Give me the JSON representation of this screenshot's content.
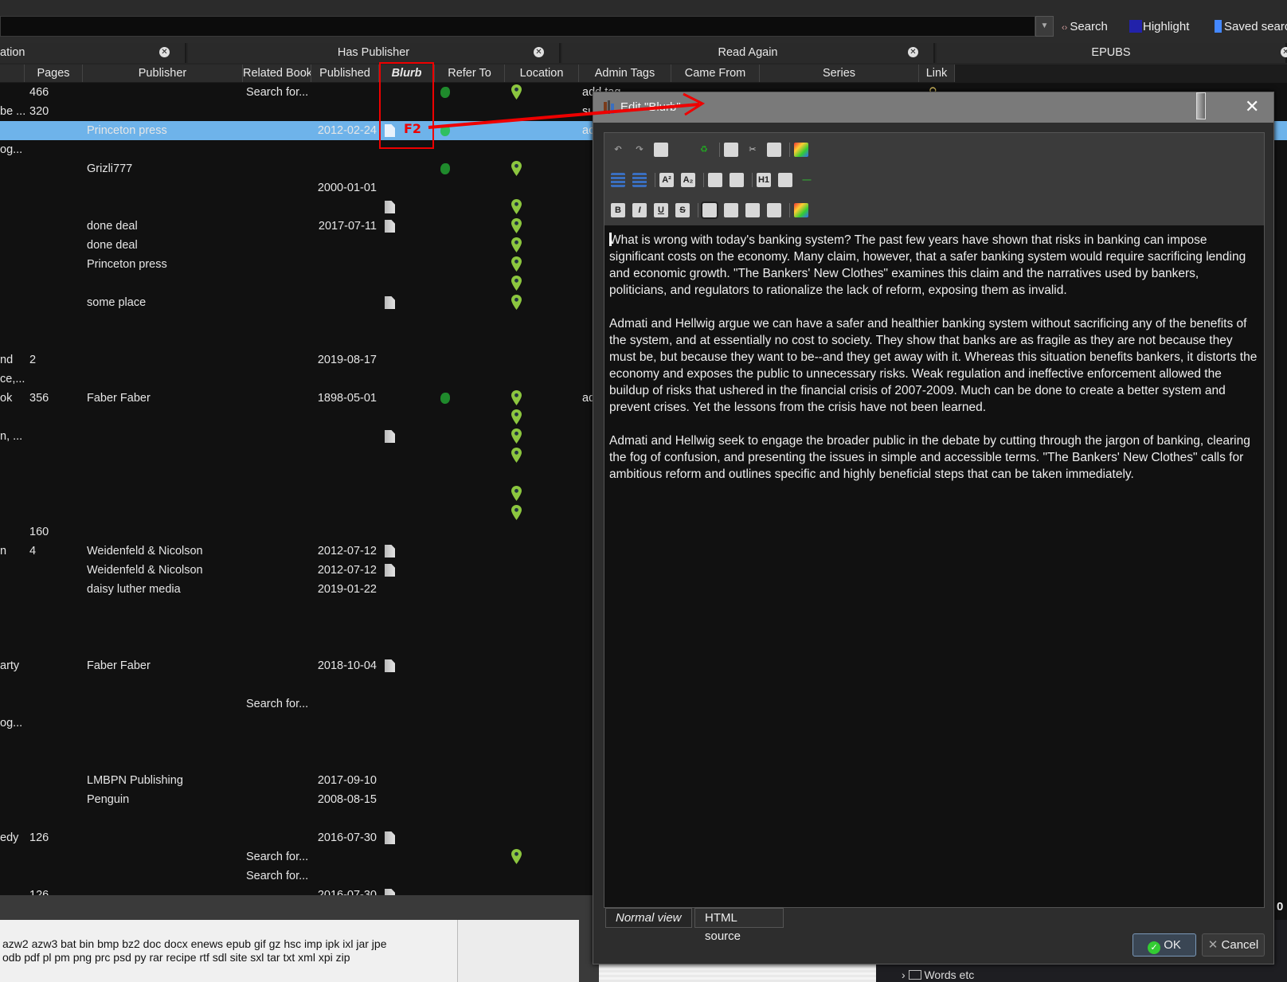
{
  "search": {
    "value": "",
    "buttons": [
      {
        "label": "Search",
        "icon": "search-icon"
      },
      {
        "label": "Highlight",
        "icon": "highlight-icon"
      },
      {
        "label": "Saved searc",
        "icon": "bookmark-icon"
      }
    ]
  },
  "tabs": [
    {
      "label": "ation"
    },
    {
      "label": "Has Publisher"
    },
    {
      "label": "Read Again"
    },
    {
      "label": "EPUBS"
    }
  ],
  "columns": [
    "",
    "Pages",
    "Publisher",
    "Related Book",
    "Published",
    "Blurb",
    "Refer To",
    "Location",
    "Admin Tags",
    "Came From",
    "Series",
    "Link"
  ],
  "rows": [
    {
      "c0": "",
      "pages": "466",
      "publisher": "",
      "related": "Search for...",
      "published": "",
      "blurb": false,
      "refer": true,
      "location": true,
      "admin": "add tag",
      "link": true
    },
    {
      "c0": "be ...",
      "pages": "320",
      "publisher": "",
      "related": "",
      "published": "",
      "blurb": false,
      "refer": false,
      "location": false,
      "admin": "su"
    },
    {
      "c0": "",
      "pages": "",
      "publisher": "Princeton press",
      "related": "",
      "published": "2012-02-24",
      "blurb": true,
      "refer": true,
      "location": false,
      "admin": "ac",
      "selected": true
    },
    {
      "c0": "og...",
      "pages": "",
      "publisher": "",
      "related": "",
      "published": "",
      "blurb": false,
      "refer": false,
      "location": false,
      "admin": ""
    },
    {
      "c0": "",
      "pages": "",
      "publisher": "Grizli777",
      "related": "",
      "published": "",
      "blurb": false,
      "refer": true,
      "location": true,
      "admin": ""
    },
    {
      "c0": "",
      "pages": "",
      "publisher": "",
      "related": "",
      "published": "2000-01-01",
      "blurb": false,
      "refer": false,
      "location": false,
      "admin": ""
    },
    {
      "c0": "",
      "pages": "",
      "publisher": "",
      "related": "",
      "published": "",
      "blurb": true,
      "refer": false,
      "location": true,
      "admin": ""
    },
    {
      "c0": "",
      "pages": "",
      "publisher": "done deal",
      "related": "",
      "published": "2017-07-11",
      "blurb": true,
      "refer": false,
      "location": true,
      "admin": ""
    },
    {
      "c0": "",
      "pages": "",
      "publisher": "done deal",
      "related": "",
      "published": "",
      "blurb": false,
      "refer": false,
      "location": true,
      "admin": ""
    },
    {
      "c0": "",
      "pages": "",
      "publisher": "Princeton press",
      "related": "",
      "published": "",
      "blurb": false,
      "refer": false,
      "location": true,
      "admin": ""
    },
    {
      "c0": "",
      "pages": "",
      "publisher": "",
      "related": "",
      "published": "",
      "blurb": false,
      "refer": false,
      "location": true,
      "admin": ""
    },
    {
      "c0": "",
      "pages": "",
      "publisher": "some place",
      "related": "",
      "published": "",
      "blurb": true,
      "refer": false,
      "location": true,
      "admin": ""
    },
    {
      "c0": "",
      "pages": "",
      "publisher": "",
      "related": "",
      "published": "",
      "blurb": false,
      "refer": false,
      "location": false,
      "admin": ""
    },
    {
      "c0": "",
      "pages": "",
      "publisher": "",
      "related": "",
      "published": "",
      "blurb": false,
      "refer": false,
      "location": false,
      "admin": ""
    },
    {
      "c0": "nd",
      "pages": "2",
      "publisher": "",
      "related": "",
      "published": "2019-08-17",
      "blurb": false,
      "refer": false,
      "location": false,
      "admin": ""
    },
    {
      "c0": "ce,...",
      "pages": "",
      "publisher": "",
      "related": "",
      "published": "",
      "blurb": false,
      "refer": false,
      "location": false,
      "admin": ""
    },
    {
      "c0": "ok",
      "pages": "356",
      "publisher": "Faber  Faber",
      "related": "",
      "published": "1898-05-01",
      "blurb": false,
      "refer": true,
      "location": true,
      "admin": "ad"
    },
    {
      "c0": "",
      "pages": "",
      "publisher": "",
      "related": "",
      "published": "",
      "blurb": false,
      "refer": false,
      "location": true,
      "admin": ""
    },
    {
      "c0": "n, ...",
      "pages": "",
      "publisher": "",
      "related": "",
      "published": "",
      "blurb": true,
      "refer": false,
      "location": true,
      "admin": ""
    },
    {
      "c0": "",
      "pages": "",
      "publisher": "",
      "related": "",
      "published": "",
      "blurb": false,
      "refer": false,
      "location": true,
      "admin": ""
    },
    {
      "c0": "",
      "pages": "",
      "publisher": "",
      "related": "",
      "published": "",
      "blurb": false,
      "refer": false,
      "location": false,
      "admin": ""
    },
    {
      "c0": "",
      "pages": "",
      "publisher": "",
      "related": "",
      "published": "",
      "blurb": false,
      "refer": false,
      "location": true,
      "admin": ""
    },
    {
      "c0": "",
      "pages": "",
      "publisher": "",
      "related": "",
      "published": "",
      "blurb": false,
      "refer": false,
      "location": true,
      "admin": ""
    },
    {
      "c0": "",
      "pages": "160",
      "publisher": "",
      "related": "",
      "published": "",
      "blurb": false,
      "refer": false,
      "location": false,
      "admin": ""
    },
    {
      "c0": "n",
      "pages": "4",
      "publisher": "Weidenfeld & Nicolson",
      "related": "",
      "published": "2012-07-12",
      "blurb": true,
      "refer": false,
      "location": false,
      "admin": ""
    },
    {
      "c0": "",
      "pages": "",
      "publisher": "Weidenfeld & Nicolson",
      "related": "",
      "published": "2012-07-12",
      "blurb": true,
      "refer": false,
      "location": false,
      "admin": ""
    },
    {
      "c0": "",
      "pages": "",
      "publisher": "daisy luther media",
      "related": "",
      "published": "2019-01-22",
      "blurb": false,
      "refer": false,
      "location": false,
      "admin": ""
    },
    {
      "c0": "",
      "pages": "",
      "publisher": "",
      "related": "",
      "published": "",
      "blurb": false,
      "refer": false,
      "location": false,
      "admin": ""
    },
    {
      "c0": "",
      "pages": "",
      "publisher": "",
      "related": "",
      "published": "",
      "blurb": false,
      "refer": false,
      "location": false,
      "admin": ""
    },
    {
      "c0": "",
      "pages": "",
      "publisher": "",
      "related": "",
      "published": "",
      "blurb": false,
      "refer": false,
      "location": false,
      "admin": ""
    },
    {
      "c0": "arty",
      "pages": "",
      "publisher": "Faber  Faber",
      "related": "",
      "published": "2018-10-04",
      "blurb": true,
      "refer": false,
      "location": false,
      "admin": ""
    },
    {
      "c0": "",
      "pages": "",
      "publisher": "",
      "related": "",
      "published": "",
      "blurb": false,
      "refer": false,
      "location": false,
      "admin": ""
    },
    {
      "c0": "",
      "pages": "",
      "publisher": "",
      "related": "Search for...",
      "published": "",
      "blurb": false,
      "refer": false,
      "location": false,
      "admin": ""
    },
    {
      "c0": "og...",
      "pages": "",
      "publisher": "",
      "related": "",
      "published": "",
      "blurb": false,
      "refer": false,
      "location": false,
      "admin": ""
    },
    {
      "c0": "",
      "pages": "",
      "publisher": "",
      "related": "",
      "published": "",
      "blurb": false,
      "refer": false,
      "location": false,
      "admin": ""
    },
    {
      "c0": "",
      "pages": "",
      "publisher": "",
      "related": "",
      "published": "",
      "blurb": false,
      "refer": false,
      "location": false,
      "admin": ""
    },
    {
      "c0": "",
      "pages": "",
      "publisher": "LMBPN Publishing",
      "related": "",
      "published": "2017-09-10",
      "blurb": false,
      "refer": false,
      "location": false,
      "admin": ""
    },
    {
      "c0": "",
      "pages": "",
      "publisher": "Penguin",
      "related": "",
      "published": "2008-08-15",
      "blurb": false,
      "refer": false,
      "location": false,
      "admin": ""
    },
    {
      "c0": "",
      "pages": "",
      "publisher": "",
      "related": "",
      "published": "",
      "blurb": false,
      "refer": false,
      "location": false,
      "admin": ""
    },
    {
      "c0": "edy",
      "pages": "126",
      "publisher": "",
      "related": "",
      "published": "2016-07-30",
      "blurb": true,
      "refer": false,
      "location": false,
      "admin": ""
    },
    {
      "c0": "",
      "pages": "",
      "publisher": "",
      "related": "Search for...",
      "published": "",
      "blurb": false,
      "refer": false,
      "location": true,
      "admin": ""
    },
    {
      "c0": "",
      "pages": "",
      "publisher": "",
      "related": "Search for...",
      "published": "",
      "blurb": false,
      "refer": false,
      "location": false,
      "admin": ""
    },
    {
      "c0": "",
      "pages": "126",
      "publisher": "",
      "related": "",
      "published": "2016-07-30",
      "blurb": true,
      "refer": false,
      "location": false,
      "admin": ""
    }
  ],
  "annotation": {
    "label": "F2",
    "color": "#e00000"
  },
  "extensions": {
    "line1": "azw2 azw3 bat bin bmp bz2 doc docx enews epub gif gz hsc imp ipk ixl jar jpe",
    "line2": "odb pdf pl pm png prc psd py rar recipe rtf sdl site sxl tar txt xml xpi zip"
  },
  "tree": {
    "item": "Words etc"
  },
  "right_counter": "0",
  "dialog": {
    "title": "Edit \"Blurb\"",
    "toolbar": [
      [
        "undo-icon",
        "redo-icon",
        "paste-text-icon",
        "clear-formatting-icon",
        "recycle-icon",
        "|",
        "copy-icon",
        "cut-icon",
        "paste-icon",
        "|",
        "background-color-icon"
      ],
      [
        "ordered-list-icon",
        "unordered-list-icon",
        "|",
        "superscript-icon",
        "subscript-icon",
        "|",
        "outdent-icon",
        "indent-icon",
        "|",
        "heading-icon",
        "anchor-icon",
        "horizontal-rule-icon"
      ],
      [
        "bold-icon",
        "italic-icon",
        "underline-icon",
        "strikethrough-icon",
        "|",
        "align-left-icon",
        "align-center-icon",
        "align-right-icon",
        "align-justify-icon",
        "|",
        "text-color-icon"
      ]
    ],
    "paragraphs": [
      "What is wrong with today's banking system? The past few years have shown that risks in banking can impose significant costs on the economy. Many claim, however, that a safer banking system would require sacrificing lending and economic growth. \"The Bankers' New Clothes\" examines this claim and the narratives used by bankers, politicians, and regulators to rationalize the lack of reform, exposing them as invalid.",
      "Admati and Hellwig argue we can have a safer and healthier banking system without sacrificing any of the benefits of the system, and at essentially no cost to society. They show that banks are as fragile as they are not because they must be, but because they want to be--and they get away with it. Whereas this situation benefits bankers, it distorts the economy and exposes the public to unnecessary risks. Weak regulation and ineffective enforcement allowed the buildup of risks that ushered in the financial crisis of 2007-2009. Much can be done to create a better system and prevent crises. Yet the lessons from the crisis have not been learned.",
      "Admati and Hellwig seek to engage the broader public in the debate by cutting through the jargon of banking, clearing the fog of confusion, and presenting the issues in simple and accessible terms. \"The Bankers' New Clothes\" calls for ambitious reform and outlines specific and highly beneficial steps that can be taken immediately."
    ],
    "view_tabs": [
      {
        "label": "Normal view",
        "active": true
      },
      {
        "label": "HTML source",
        "active": false
      }
    ],
    "ok_label": "OK",
    "cancel_label": "Cancel"
  }
}
